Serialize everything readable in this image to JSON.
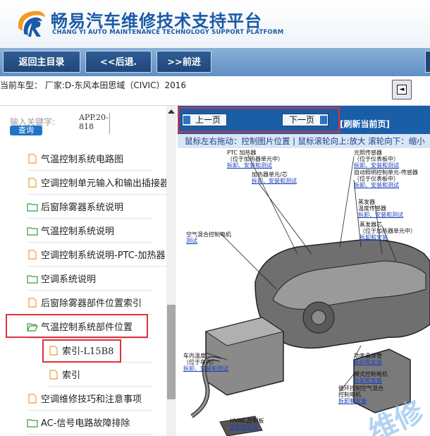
{
  "header": {
    "title_cn": "畅易汽车维修技术支持平台",
    "title_en": "CHANG YI AUTO MAINTENANCE TECHNOLOGY SUPPORT PLATFORM"
  },
  "nav": {
    "home_label": "返回主目录",
    "back_label": "<<后退.",
    "forward_label": ">>前进"
  },
  "car": {
    "model_label": "当前车型：  厂家:D-东风本田思域（CIVIC）2016",
    "button_icon": "toggle-icon"
  },
  "sidebar": {
    "search_label": "输入关键字:",
    "search_value": "APP.20-818",
    "search_button": "查询",
    "items": [
      {
        "label": "气温控制系统电路图",
        "icon": "document-icon"
      },
      {
        "label": "空调控制单元输入和输出插接器",
        "icon": "document-icon"
      },
      {
        "label": "后窗除雾器系统说明",
        "icon": "folder-icon"
      },
      {
        "label": "气温控制系统说明",
        "icon": "folder-icon"
      },
      {
        "label": "空调控制系统说明-PTC-加热器",
        "icon": "document-icon"
      },
      {
        "label": "空调系统说明",
        "icon": "folder-icon"
      },
      {
        "label": "后窗除雾器部件位置索引",
        "icon": "document-icon"
      },
      {
        "label": "气温控制系统部件位置",
        "icon": "folder-open-icon"
      },
      {
        "label": "索引-L15B8",
        "icon": "document-icon"
      },
      {
        "label": "索引",
        "icon": "document-icon"
      },
      {
        "label": "空调维修技巧和注意事项",
        "icon": "document-icon"
      },
      {
        "label": "AC-信号电路故障排除",
        "icon": "folder-icon"
      }
    ]
  },
  "viewer": {
    "prev_label": "上一页",
    "next_label": "下一页",
    "refresh_label": "[刷新当前页]",
    "hint": "鼠标左右拖动：控制图片位置 | 鼠标滚轮向上:放大   滚轮向下：缩小",
    "callouts": [
      {
        "title": "PTC 加热器",
        "sub": "（位于加热器单元中）",
        "link": "拆卸、安装和测试"
      },
      {
        "title": "加热器单元/芯",
        "sub": "",
        "link": "拆卸、安装和测试"
      },
      {
        "title": "光照传感器",
        "sub": "（位于仪表板中）",
        "link": "拆卸、安装和测试"
      },
      {
        "title": "自动照明控制单元-传感器",
        "sub": "（位于仪表板中）",
        "link": "拆卸、安装和测试"
      },
      {
        "title": "蒸发器",
        "sub": "温度传感器",
        "link": "拆卸、安装和测试"
      },
      {
        "title": "蒸发器芯",
        "sub": "（位于加热器单元中）",
        "link": "拆卸和安装"
      },
      {
        "title": "空气混合控制电机",
        "sub": "",
        "link": "测试"
      },
      {
        "title": "车内温度",
        "sub": "（位于车内）",
        "link": "拆卸、安装和测试"
      },
      {
        "title": "功率晶体管",
        "sub": "",
        "link": "拆卸和安装"
      },
      {
        "title": "模式控制电机",
        "sub": "",
        "link": "拆卸和安装"
      },
      {
        "title": "循环控制空气混合",
        "sub": "控制电机",
        "link": "拆卸和安装"
      },
      {
        "title": "HVAC 控制板",
        "sub": "",
        "link": "拆卸和安装"
      }
    ]
  },
  "colors": {
    "brand_blue": "#1a5aa6",
    "highlight_red": "#e0303a",
    "toolbar_blue": "#1b5ea8"
  }
}
